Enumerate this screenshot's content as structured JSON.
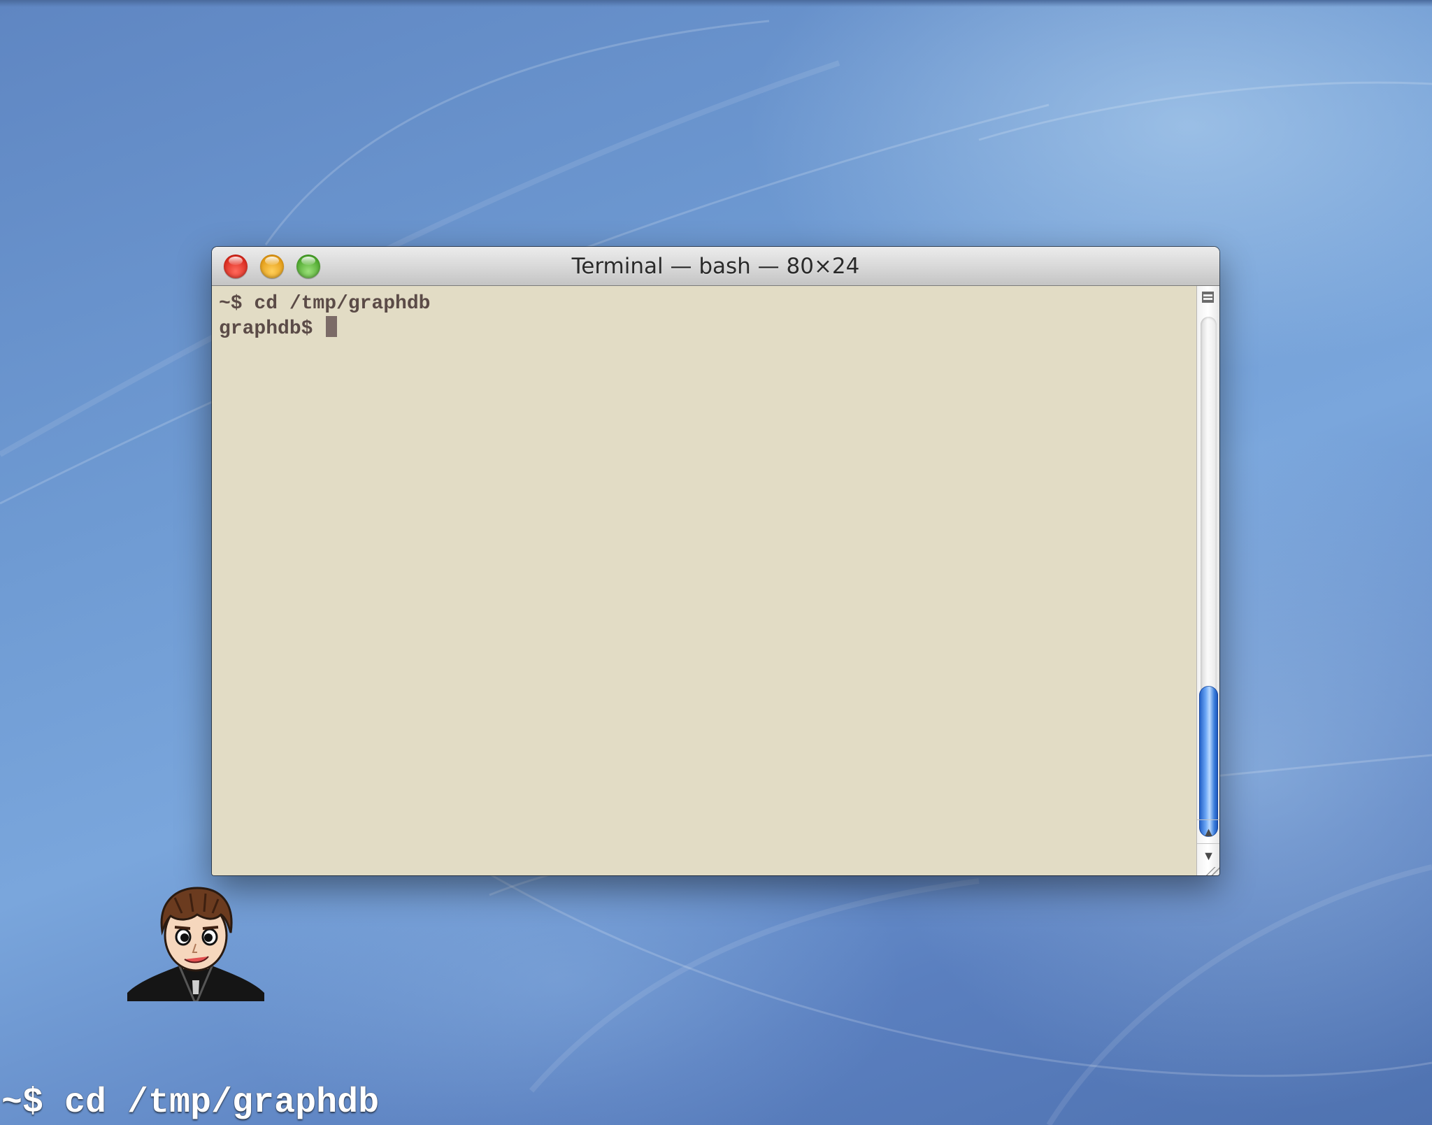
{
  "window": {
    "title": "Terminal — bash — 80×24",
    "lines": [
      "~$ cd /tmp/graphdb",
      "graphdb$ "
    ]
  },
  "caption": "~$ cd /tmp/graphdb",
  "icons": {
    "close": "close-button",
    "minimize": "minimize-button",
    "zoom": "zoom-button",
    "split": "split-pane-icon",
    "scroll_up": "scroll-up-arrow-icon",
    "scroll_down": "scroll-down-arrow-icon",
    "resize": "resize-grip-icon",
    "avatar": "presenter-avatar"
  },
  "colors": {
    "terminal_bg": "#e2dcc5",
    "terminal_text": "#5b4b47",
    "caption_text": "#ffffff"
  }
}
